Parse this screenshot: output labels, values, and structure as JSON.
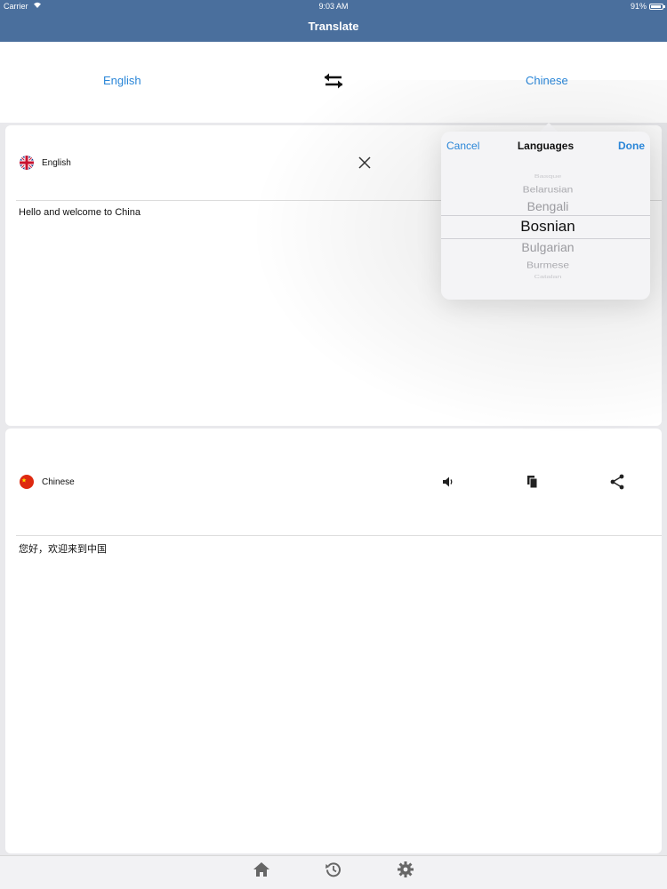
{
  "status_bar": {
    "carrier": "Carrier",
    "time": "9:03 AM",
    "battery": "91%"
  },
  "nav": {
    "title": "Translate"
  },
  "lang_bar": {
    "source": "English",
    "target": "Chinese",
    "swap_icon": "swap-arrows-icon"
  },
  "source_panel": {
    "language": "English",
    "flag": "uk-flag-icon",
    "text": "Hello and welcome to China",
    "clear_icon": "close-icon"
  },
  "target_panel": {
    "language": "Chinese",
    "flag": "china-flag-icon",
    "text": "您好，欢迎来到中国",
    "icons": [
      "speaker-icon",
      "copy-icon",
      "share-icon"
    ]
  },
  "popover": {
    "cancel": "Cancel",
    "title": "Languages",
    "done": "Done",
    "options": [
      "Basque",
      "Belarusian",
      "Bengali",
      "Bosnian",
      "Bulgarian",
      "Burmese",
      "Catalan"
    ],
    "selected": "Bosnian"
  },
  "tab_bar": {
    "items": [
      "home-icon",
      "history-icon",
      "settings-icon"
    ]
  },
  "colors": {
    "nav_bg": "#4a6f9d",
    "accent": "#2a86d8"
  }
}
